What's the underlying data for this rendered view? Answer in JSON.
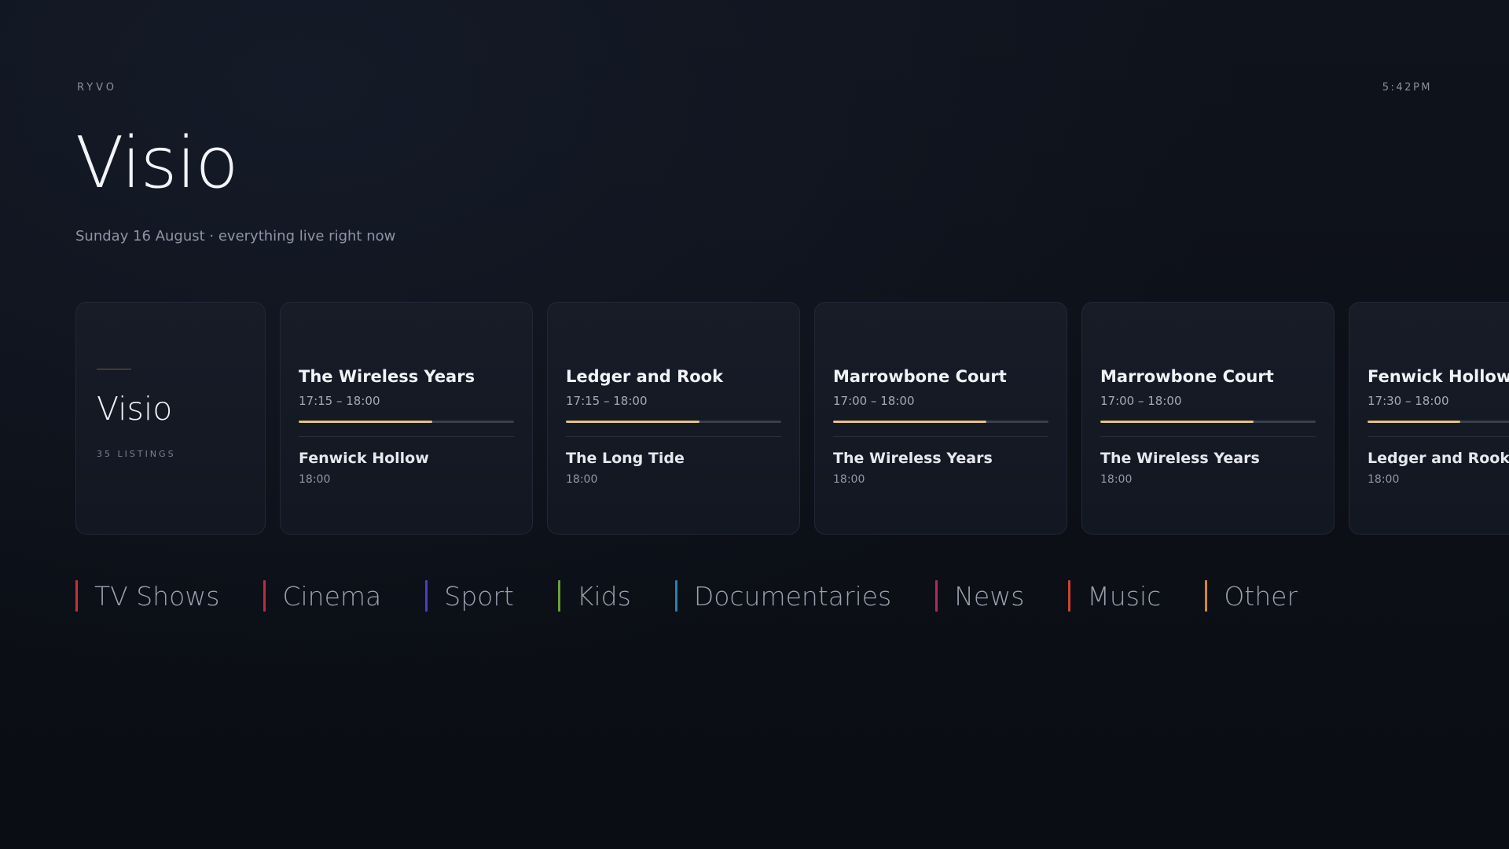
{
  "header": {
    "brand": "RYVO",
    "clock": "5:42PM",
    "title": "Visio",
    "subtitle": "Sunday 16 August · everything live right now"
  },
  "channel": {
    "name": "Visio",
    "count_label": "35 LISTINGS"
  },
  "cards": [
    {
      "now_title": "The Wireless Years",
      "now_time": "17:15 – 18:00",
      "progress": 0.62,
      "next_title": "Fenwick Hollow",
      "next_time": "18:00"
    },
    {
      "now_title": "Ledger and Rook",
      "now_time": "17:15 – 18:00",
      "progress": 0.62,
      "next_title": "The Long Tide",
      "next_time": "18:00"
    },
    {
      "now_title": "Marrowbone Court",
      "now_time": "17:00 – 18:00",
      "progress": 0.71,
      "next_title": "The Wireless Years",
      "next_time": "18:00"
    },
    {
      "now_title": "Marrowbone Court",
      "now_time": "17:00 – 18:00",
      "progress": 0.71,
      "next_title": "The Wireless Years",
      "next_time": "18:00"
    },
    {
      "now_title": "Fenwick Hollow",
      "now_time": "17:30 – 18:00",
      "progress": 0.43,
      "next_title": "Ledger and Rook",
      "next_time": "18:00"
    }
  ],
  "categories": [
    {
      "label": "TV Shows",
      "color": "#c6303d"
    },
    {
      "label": "Cinema",
      "color": "#c02a44"
    },
    {
      "label": "Sport",
      "color": "#4a3fc2"
    },
    {
      "label": "Kids",
      "color": "#6aa03a"
    },
    {
      "label": "Documentaries",
      "color": "#2d7fb0"
    },
    {
      "label": "News",
      "color": "#b02a5e"
    },
    {
      "label": "Music",
      "color": "#c8452e"
    },
    {
      "label": "Other",
      "color": "#d08a2c"
    }
  ],
  "colors": {
    "progress_fill": "#e7c27f",
    "background": "#0b0e14"
  }
}
